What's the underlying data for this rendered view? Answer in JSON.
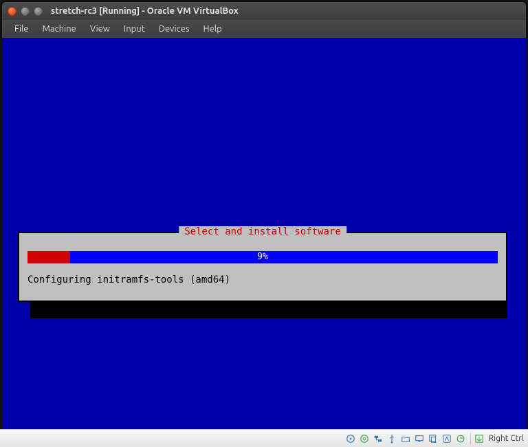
{
  "window": {
    "title": "stretch-rc3 [Running] - Oracle VM VirtualBox"
  },
  "menu": {
    "file": "File",
    "machine": "Machine",
    "view": "View",
    "input": "Input",
    "devices": "Devices",
    "help": "Help"
  },
  "installer": {
    "title": "Select and install software",
    "percent_text": "9%",
    "percent_value": 9,
    "status": "Configuring initramfs-tools (amd64)"
  },
  "statusbar": {
    "host_key": "Right Ctrl"
  }
}
